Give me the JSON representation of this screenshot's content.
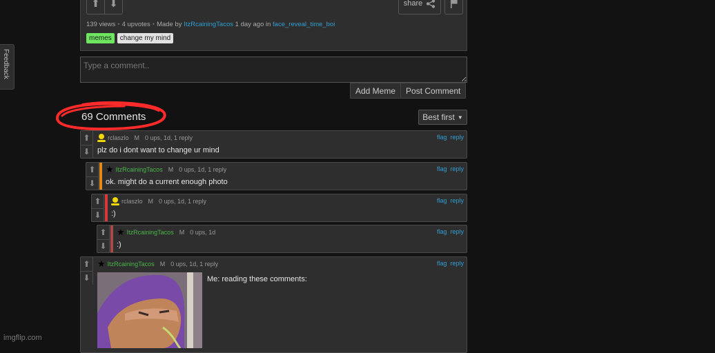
{
  "post": {
    "views": "139 views",
    "upvotes": "4 upvotes",
    "made_by_label": "Made by",
    "author": "ItzRcainingTacos",
    "time_label": "1 day ago in",
    "stream": "face_reveal_time_boi",
    "share_label": "share",
    "tags": [
      "memes",
      "change my mind"
    ]
  },
  "comment_form": {
    "placeholder": "Type a comment..",
    "value": "",
    "add_meme_label": "Add Meme",
    "post_comment_label": "Post Comment"
  },
  "comments_header": {
    "count_label": "69 Comments",
    "sort_label": "Best first"
  },
  "comments": [
    {
      "user": "rclaszlo",
      "role": "M",
      "stats": "0 ups, 1d, 1 reply",
      "text": "plz do i dont want to change ur mind",
      "flag": "flag",
      "reply": "reply"
    },
    {
      "user": "ItzRcainingTacos",
      "role": "M",
      "stats": "0 ups, 1d, 1 reply",
      "text": "ok. might do a current enough photo",
      "flag": "flag",
      "reply": "reply"
    },
    {
      "user": "rclaszlo",
      "role": "M",
      "stats": "0 ups, 1d, 1 reply",
      "text": ":)",
      "flag": "flag",
      "reply": "reply"
    },
    {
      "user": "ItzRcainingTacos",
      "role": "M",
      "stats": "0 ups, 1d",
      "text": ":)",
      "flag": "flag",
      "reply": "reply"
    },
    {
      "user": "ItzRcainingTacos",
      "role": "M",
      "stats": "0 ups, 1d, 1 reply",
      "text": "Me: reading these comments:",
      "flag": "flag",
      "reply": "reply"
    }
  ],
  "feedback_label": "Feedback",
  "watermark": "imgflip.com",
  "colors": {
    "link": "#2f9fd3",
    "mod_green": "#49b649",
    "tag_green": "#6ee65f",
    "thread_orange": "#e88a1a",
    "thread_red": "#d9383a",
    "thread_darkred": "#a84a4a",
    "annotation_red": "#ff2a2a"
  }
}
